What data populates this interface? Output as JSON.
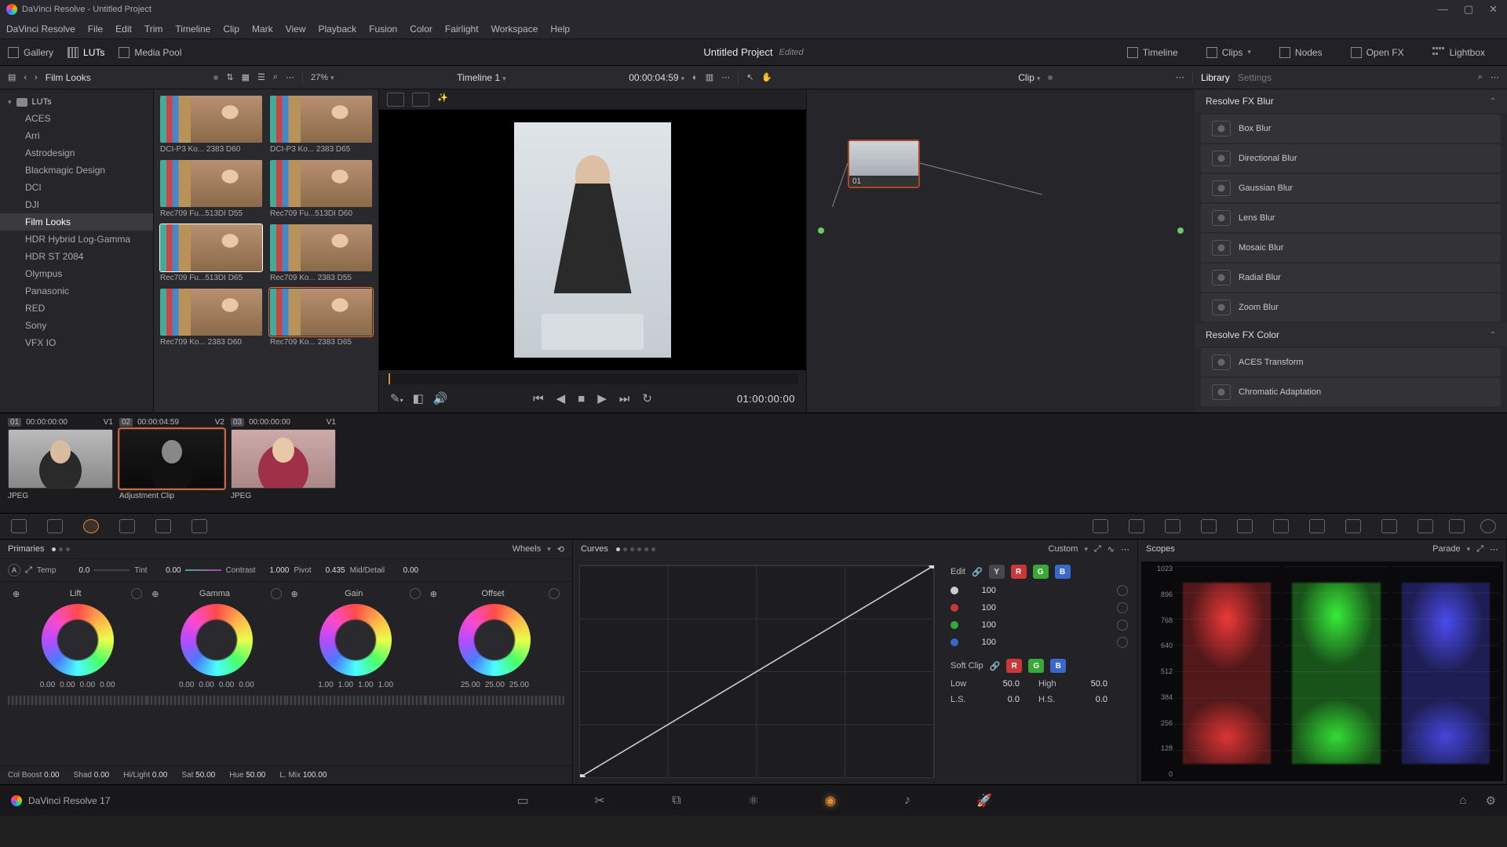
{
  "titlebar": {
    "app": "DaVinci Resolve",
    "project": "Untitled Project"
  },
  "menu": [
    "DaVinci Resolve",
    "File",
    "Edit",
    "Trim",
    "Timeline",
    "Clip",
    "Mark",
    "View",
    "Playback",
    "Fusion",
    "Color",
    "Fairlight",
    "Workspace",
    "Help"
  ],
  "toolbar": {
    "gallery": "Gallery",
    "luts": "LUTs",
    "mediapool": "Media Pool",
    "project": "Untitled Project",
    "edited": "Edited",
    "timeline": "Timeline",
    "clips": "Clips",
    "nodes": "Nodes",
    "openfx": "Open FX",
    "lightbox": "Lightbox"
  },
  "subhead": {
    "back_fwd": true,
    "browser_title": "Film Looks",
    "zoom": "27%",
    "timeline_name": "Timeline 1",
    "timecode": "00:00:04:59",
    "clip_label": "Clip",
    "library": "Library",
    "settings": "Settings"
  },
  "luts_tree": {
    "root": "LUTs",
    "items": [
      "ACES",
      "Arri",
      "Astrodesign",
      "Blackmagic Design",
      "DCI",
      "DJI",
      "Film Looks",
      "HDR Hybrid Log-Gamma",
      "HDR ST 2084",
      "Olympus",
      "Panasonic",
      "RED",
      "Sony",
      "VFX IO"
    ],
    "active": 6
  },
  "lut_thumbs": [
    {
      "cap": "DCI-P3 Ko... 2383 D60"
    },
    {
      "cap": "DCI-P3 Ko... 2383 D65"
    },
    {
      "cap": "Rec709 Fu...513DI D55"
    },
    {
      "cap": "Rec709 Fu...513DI D60"
    },
    {
      "cap": "Rec709 Fu...513DI D65",
      "hover": true
    },
    {
      "cap": "Rec709 Ko... 2383 D55"
    },
    {
      "cap": "Rec709 Ko... 2383 D60"
    },
    {
      "cap": "Rec709 Ko... 2383 D65",
      "sel": true
    }
  ],
  "viewer": {
    "tc": "01:00:00:00"
  },
  "node": {
    "label": "01"
  },
  "fx": {
    "cat1": "Resolve FX Blur",
    "blur_items": [
      "Box Blur",
      "Directional Blur",
      "Gaussian Blur",
      "Lens Blur",
      "Mosaic Blur",
      "Radial Blur",
      "Zoom Blur"
    ],
    "cat2": "Resolve FX Color",
    "color_items": [
      "ACES Transform",
      "Chromatic Adaptation"
    ]
  },
  "clips": [
    {
      "idx": "01",
      "tc": "00:00:00:00",
      "trk": "V1",
      "name": "JPEG"
    },
    {
      "idx": "02",
      "tc": "00:00:04:59",
      "trk": "V2",
      "name": "Adjustment Clip",
      "sel": true
    },
    {
      "idx": "03",
      "tc": "00:00:00:00",
      "trk": "V1",
      "name": "JPEG"
    }
  ],
  "primaries": {
    "title": "Primaries",
    "mode": "Wheels",
    "adj": [
      {
        "l": "Temp",
        "v": "0.0"
      },
      {
        "l": "Tint",
        "v": "0.00"
      },
      {
        "l": "Contrast",
        "v": "1.000"
      },
      {
        "l": "Pivot",
        "v": "0.435"
      },
      {
        "l": "Mid/Detail",
        "v": "0.00"
      }
    ],
    "wheels": [
      {
        "name": "Lift",
        "vals": [
          "0.00",
          "0.00",
          "0.00",
          "0.00"
        ]
      },
      {
        "name": "Gamma",
        "vals": [
          "0.00",
          "0.00",
          "0.00",
          "0.00"
        ]
      },
      {
        "name": "Gain",
        "vals": [
          "1.00",
          "1.00",
          "1.00",
          "1.00"
        ]
      },
      {
        "name": "Offset",
        "vals": [
          "25.00",
          "25.00",
          "25.00"
        ]
      }
    ],
    "globals": [
      {
        "l": "Col Boost",
        "v": "0.00"
      },
      {
        "l": "Shad",
        "v": "0.00"
      },
      {
        "l": "Hi/Light",
        "v": "0.00"
      },
      {
        "l": "Sat",
        "v": "50.00"
      },
      {
        "l": "Hue",
        "v": "50.00"
      },
      {
        "l": "L. Mix",
        "v": "100.00"
      }
    ]
  },
  "curves": {
    "title": "Curves",
    "mode": "Custom",
    "edit": "Edit",
    "ch_vals": [
      "100",
      "100",
      "100",
      "100"
    ],
    "softclip": "Soft Clip",
    "low_l": "Low",
    "low_v": "50.0",
    "high_l": "High",
    "high_v": "50.0",
    "ls_l": "L.S.",
    "ls_v": "0.0",
    "hs_l": "H.S.",
    "hs_v": "0.0"
  },
  "scopes": {
    "title": "Scopes",
    "mode": "Parade",
    "ticks": [
      "1023",
      "896",
      "768",
      "640",
      "512",
      "384",
      "256",
      "128",
      "0"
    ]
  },
  "footer": {
    "app": "DaVinci Resolve 17"
  }
}
